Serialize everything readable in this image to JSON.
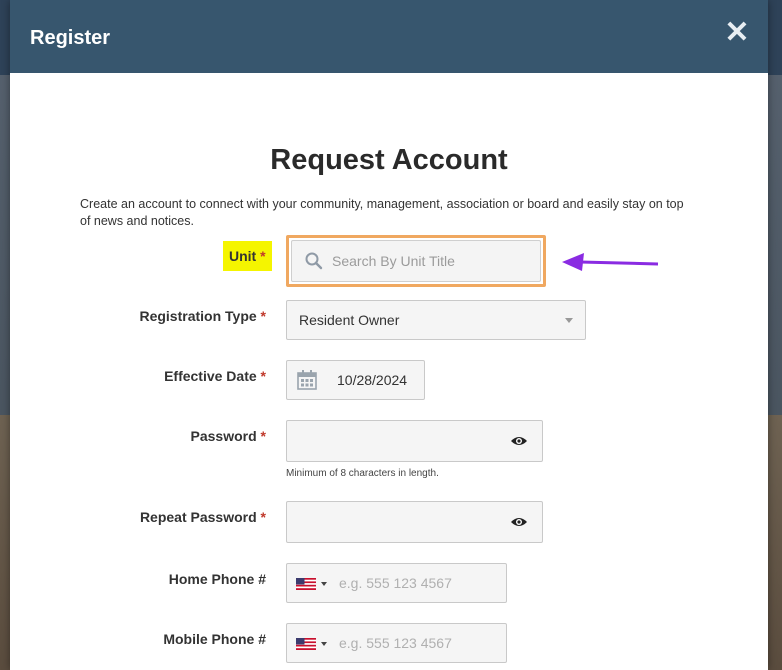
{
  "modal": {
    "title": "Register",
    "close_glyph": "✕",
    "heading": "Request Account",
    "intro": "Create an account to connect with your community, management, association or board and easily stay on top of news and notices."
  },
  "fields": {
    "unit": {
      "label": "Unit",
      "required": "*",
      "placeholder": "Search By Unit Title",
      "icon": "search-icon"
    },
    "registration_type": {
      "label": "Registration Type",
      "required": "*",
      "value": "Resident Owner",
      "icon": "chevron-down-icon"
    },
    "effective_date": {
      "label": "Effective Date",
      "required": "*",
      "value": "10/28/2024",
      "icon": "calendar-icon"
    },
    "password": {
      "label": "Password",
      "required": "*",
      "hint": "Minimum of 8 characters in length.",
      "icon": "eye-icon"
    },
    "repeat_password": {
      "label": "Repeat Password",
      "required": "*",
      "icon": "eye-icon"
    },
    "home_phone": {
      "label": "Home Phone #",
      "placeholder": "e.g. 555 123 4567",
      "icon": "us-flag-icon"
    },
    "mobile_phone": {
      "label": "Mobile Phone #",
      "placeholder": "e.g. 555 123 4567",
      "icon": "us-flag-icon"
    }
  },
  "colors": {
    "header": "#37566e",
    "highlight": "#f5f500",
    "outline": "#f0a860",
    "arrow": "#8a2be2",
    "required": "#c0392b"
  }
}
